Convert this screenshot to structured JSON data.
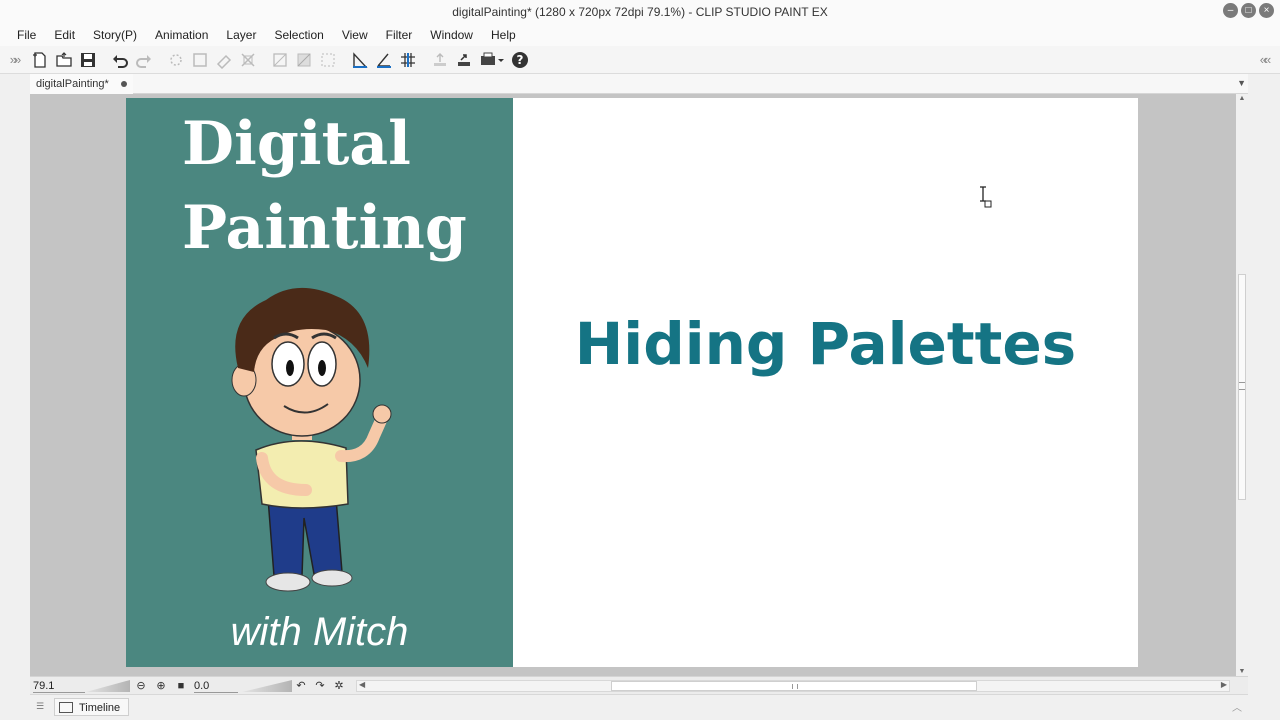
{
  "window": {
    "title": "digitalPainting* (1280 x 720px 72dpi 79.1%)  - CLIP STUDIO PAINT EX"
  },
  "menu": {
    "items": [
      "File",
      "Edit",
      "Story(P)",
      "Animation",
      "Layer",
      "Selection",
      "View",
      "Filter",
      "Window",
      "Help"
    ]
  },
  "toolbar": {
    "icons": [
      "new-file-icon",
      "open-folder-icon",
      "save-icon",
      "undo-icon",
      "redo-icon",
      "clear-icon",
      "transform-icon",
      "erase-selection-icon",
      "fit-icon",
      "flip-icon",
      "fill-icon",
      "select-all-icon",
      "ruler-snap-icon",
      "special-ruler-snap-icon",
      "grid-snap-icon",
      "export-icon",
      "export-arrow-icon",
      "print-icon",
      "help-icon"
    ]
  },
  "document_tab": {
    "label": "digitalPainting*"
  },
  "artwork": {
    "title_line1": "Digital",
    "title_line2": "Painting",
    "subtitle": "with Mitch",
    "headline": "Hiding Palettes",
    "panel_color": "#4b8780",
    "headline_color": "#157484"
  },
  "statusbar": {
    "zoom": "79.1",
    "rotation": "0.0"
  },
  "bottom_panel": {
    "timeline_label": "Timeline"
  }
}
